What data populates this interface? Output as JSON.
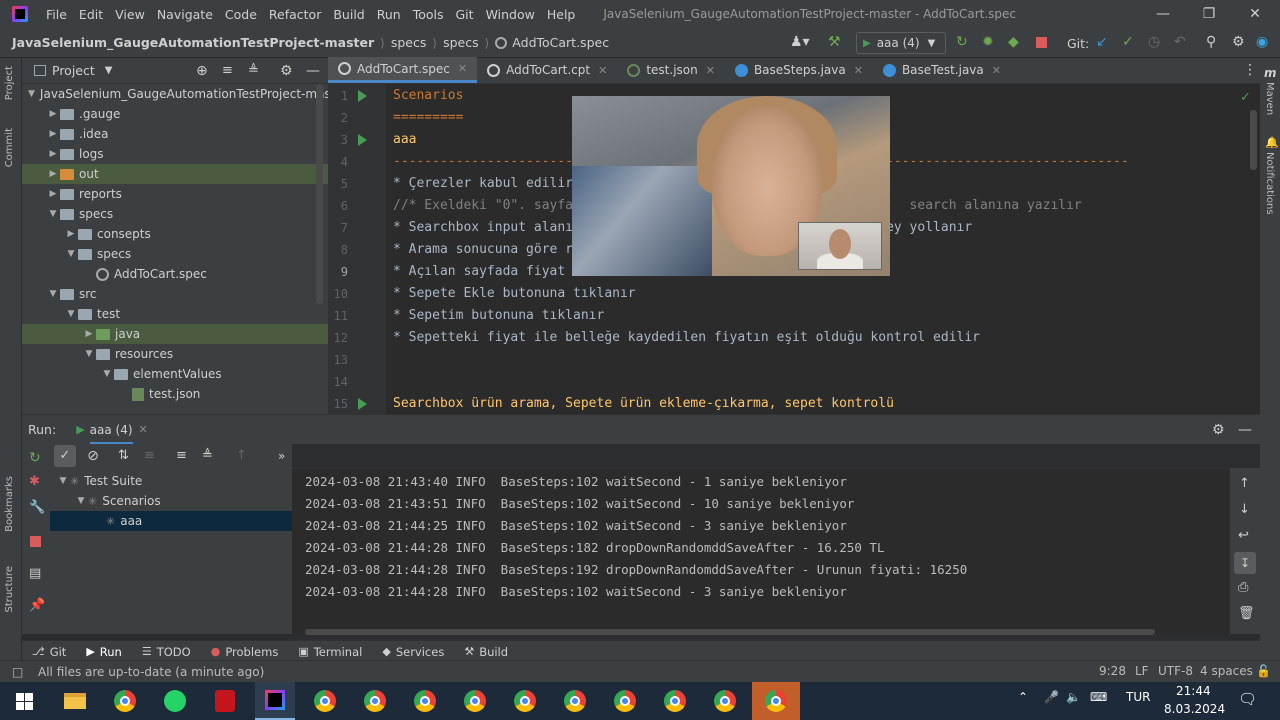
{
  "window": {
    "menu": [
      "File",
      "Edit",
      "View",
      "Navigate",
      "Code",
      "Refactor",
      "Build",
      "Run",
      "Tools",
      "Git",
      "Window",
      "Help"
    ],
    "title": "JavaSelenium_GaugeAutomationTestProject-master - AddToCart.spec"
  },
  "navbar": {
    "breadcrumbs": [
      "JavaSelenium_GaugeAutomationTestProject-master",
      "specs",
      "specs",
      "AddToCart.spec"
    ],
    "run_config": "aaa (4)",
    "git_label": "Git:"
  },
  "left_stripe": [
    "Project",
    "Commit",
    "Bookmarks",
    "Structure"
  ],
  "right_stripe": [
    "Maven",
    "Notifications"
  ],
  "project": {
    "header": "Project",
    "tree": [
      {
        "label": "JavaSelenium_GaugeAutomationTestProject-mast",
        "depth": 0,
        "open": true,
        "kind": "folder"
      },
      {
        "label": ".gauge",
        "depth": 1,
        "open": false,
        "kind": "folder"
      },
      {
        "label": ".idea",
        "depth": 1,
        "open": false,
        "kind": "folder"
      },
      {
        "label": "logs",
        "depth": 1,
        "open": false,
        "kind": "folder"
      },
      {
        "label": "out",
        "depth": 1,
        "open": false,
        "kind": "folder-orange"
      },
      {
        "label": "reports",
        "depth": 1,
        "open": false,
        "kind": "folder"
      },
      {
        "label": "specs",
        "depth": 1,
        "open": true,
        "kind": "folder"
      },
      {
        "label": "consepts",
        "depth": 2,
        "open": false,
        "kind": "folder"
      },
      {
        "label": "specs",
        "depth": 2,
        "open": true,
        "kind": "folder"
      },
      {
        "label": "AddToCart.spec",
        "depth": 3,
        "open": null,
        "kind": "spec"
      },
      {
        "label": "src",
        "depth": 1,
        "open": true,
        "kind": "folder"
      },
      {
        "label": "test",
        "depth": 2,
        "open": true,
        "kind": "folder"
      },
      {
        "label": "java",
        "depth": 3,
        "open": false,
        "kind": "folder-green"
      },
      {
        "label": "resources",
        "depth": 3,
        "open": true,
        "kind": "folder"
      },
      {
        "label": "elementValues",
        "depth": 4,
        "open": true,
        "kind": "folder"
      },
      {
        "label": "test.json",
        "depth": 5,
        "open": null,
        "kind": "json"
      }
    ]
  },
  "editor": {
    "tabs": [
      {
        "label": "AddToCart.spec",
        "active": true,
        "icon": "spec-icon"
      },
      {
        "label": "AddToCart.cpt",
        "active": false,
        "icon": "spec-icon"
      },
      {
        "label": "test.json",
        "active": false,
        "icon": "json-icon"
      },
      {
        "label": "BaseSteps.java",
        "active": false,
        "icon": "class-icon"
      },
      {
        "label": "BaseTest.java",
        "active": false,
        "icon": "class-icon"
      }
    ],
    "lines": [
      {
        "n": "1",
        "text": "Scenarios",
        "style": "orange",
        "run": true
      },
      {
        "n": "2",
        "text": "=========",
        "style": "orange",
        "run": false
      },
      {
        "n": "3",
        "text": "aaa",
        "style": "yellow",
        "run": true
      },
      {
        "n": "4",
        "text": "----------------------------------------------------------------------------------------------",
        "style": "orange",
        "run": false
      },
      {
        "n": "5",
        "text": "* Çerezler kabul edilir",
        "style": "normal",
        "run": false
      },
      {
        "n": "6",
        "text": "//* Exeldeki \"0\". sayfa                                           search alanına yazılır",
        "style": "gray",
        "run": false
      },
      {
        "n": "7",
        "text": "* Searchbox input alanı                                        ey yollanır",
        "style": "normal",
        "run": false
      },
      {
        "n": "8",
        "text": "* Arama sonucuna göre r",
        "style": "normal",
        "run": false
      },
      {
        "n": "9",
        "text": "* Açılan sayfada fiyat",
        "style": "normal",
        "run": false
      },
      {
        "n": "10",
        "text": "* Sepete Ekle butonuna tıklanır",
        "style": "normal",
        "run": false
      },
      {
        "n": "11",
        "text": "* Sepetim butonuna tıklanır",
        "style": "normal",
        "run": false
      },
      {
        "n": "12",
        "text": "* Sepetteki fiyat ile belleğe kaydedilen fiyatın eşit olduğu kontrol edilir",
        "style": "normal",
        "run": false
      },
      {
        "n": "13",
        "text": "",
        "style": "normal",
        "run": false
      },
      {
        "n": "14",
        "text": "",
        "style": "normal",
        "run": false
      },
      {
        "n": "15",
        "text": "Searchbox ürün arama, Sepete ürün ekleme-çıkarma, sepet kontrolü",
        "style": "yellow",
        "run": true
      }
    ]
  },
  "run_panel": {
    "label": "Run:",
    "tab": "aaa (4)",
    "tree": [
      {
        "label": "Test Suite",
        "depth": 0
      },
      {
        "label": "Scenarios",
        "depth": 1
      },
      {
        "label": "aaa",
        "depth": 2
      }
    ],
    "log": [
      "2024-03-08 21:43:40 INFO  BaseSteps:102 waitSecond - 1 saniye bekleniyor",
      "2024-03-08 21:43:51 INFO  BaseSteps:102 waitSecond - 10 saniye bekleniyor",
      "2024-03-08 21:44:25 INFO  BaseSteps:102 waitSecond - 3 saniye bekleniyor",
      "2024-03-08 21:44:28 INFO  BaseSteps:182 dropDownRandomddSaveAfter - 16.250 TL",
      "2024-03-08 21:44:28 INFO  BaseSteps:192 dropDownRandomddSaveAfter - Urunun fiyati: 16250",
      "2024-03-08 21:44:28 INFO  BaseSteps:102 waitSecond - 3 saniye bekleniyor"
    ]
  },
  "bottom_tabs": [
    {
      "label": "Git",
      "icon": "git-icon"
    },
    {
      "label": "Run",
      "icon": "run-icon",
      "active": true
    },
    {
      "label": "TODO",
      "icon": "todo-icon"
    },
    {
      "label": "Problems",
      "icon": "problems-icon"
    },
    {
      "label": "Terminal",
      "icon": "terminal-icon"
    },
    {
      "label": "Services",
      "icon": "services-icon"
    },
    {
      "label": "Build",
      "icon": "build-icon"
    }
  ],
  "status": {
    "message": "All files are up-to-date (a minute ago)",
    "position": "9:28",
    "line_sep": "LF",
    "encoding": "UTF-8",
    "indent": "4 spaces"
  },
  "taskbar": {
    "lang": "TUR",
    "time": "21:44",
    "date": "8.03.2024"
  }
}
